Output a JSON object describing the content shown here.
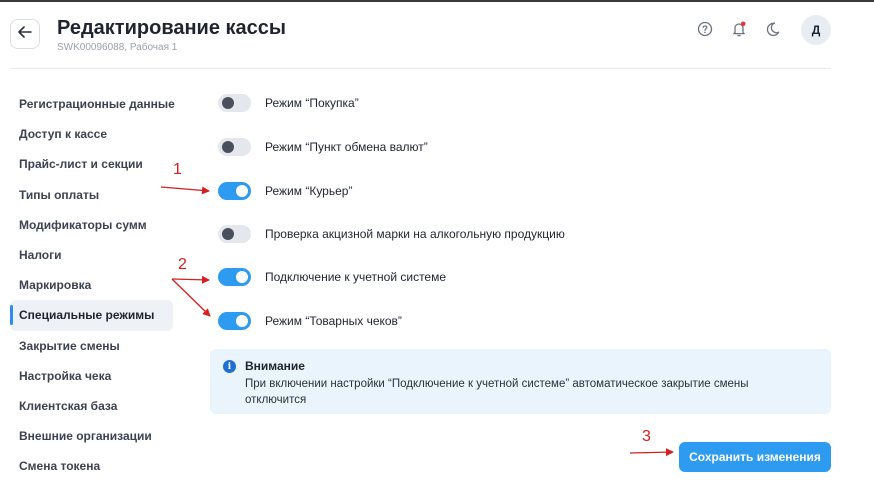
{
  "header": {
    "title": "Редактирование кассы",
    "subtitle": "SWK00096088, Рабочая 1",
    "avatar_letter": "Д",
    "icons": [
      "arrow-left-icon",
      "help-icon",
      "bell-icon",
      "moon-icon"
    ],
    "notification_dot_color": "#e53935"
  },
  "sidebar": {
    "items": [
      {
        "label": "Регистрационные данные"
      },
      {
        "label": "Доступ к кассе"
      },
      {
        "label": "Прайс-лист и секции"
      },
      {
        "label": "Типы оплаты"
      },
      {
        "label": "Модификаторы сумм"
      },
      {
        "label": "Налоги"
      },
      {
        "label": "Маркировка"
      },
      {
        "label": "Специальные режимы",
        "active": true
      },
      {
        "label": "Закрытие смены"
      },
      {
        "label": "Настройка чека"
      },
      {
        "label": "Клиентская база"
      },
      {
        "label": "Внешние организации"
      },
      {
        "label": "Смена токена"
      }
    ]
  },
  "options": [
    {
      "label": "Режим “Покупка”",
      "enabled": false
    },
    {
      "label": "Режим “Пункт обмена валют”",
      "enabled": false
    },
    {
      "label": "Режим “Курьер”",
      "enabled": true
    },
    {
      "label": "Проверка акцизной марки на алкогольную продукцию",
      "enabled": false
    },
    {
      "label": "Подключение к учетной системе",
      "enabled": true
    },
    {
      "label": "Режим “Товарных чеков”",
      "enabled": true
    }
  ],
  "notice": {
    "title": "Внимание",
    "text": "При включении настройки “Подключение к учетной системе” автоматическое закрытие смены отключится",
    "icon": "info-icon"
  },
  "actions": {
    "save_label": "Сохранить изменения"
  },
  "annotations": {
    "marks": [
      "1",
      "2",
      "3"
    ],
    "color": "#d81e1e"
  },
  "colors": {
    "accent": "#2d9bf0",
    "toggle_off": "#e4e7eb",
    "notice_bg": "#eaf4fd"
  }
}
